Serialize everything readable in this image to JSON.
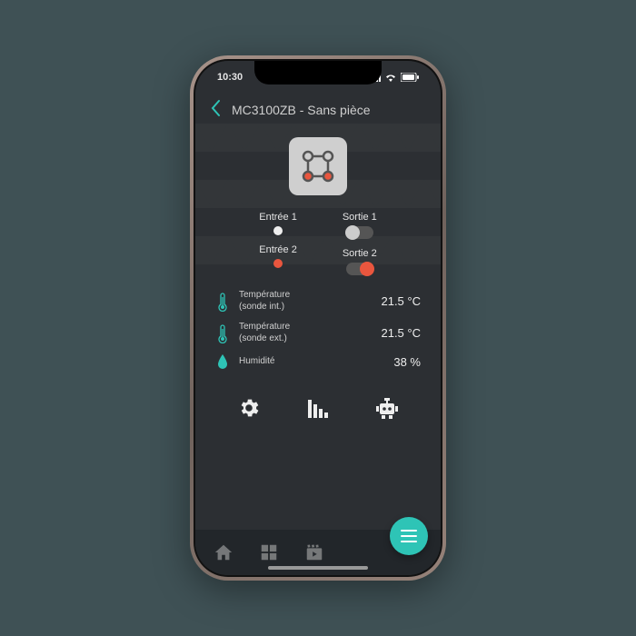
{
  "status": {
    "time": "10:30"
  },
  "header": {
    "title": "MC3100ZB - Sans pièce"
  },
  "io": {
    "input1_label": "Entrée 1",
    "input2_label": "Entrée 2",
    "output1_label": "Sortie 1",
    "output2_label": "Sortie 2"
  },
  "sensors": {
    "temp_int_label": "Température\n(sonde int.)",
    "temp_int_value": "21.5 °C",
    "temp_ext_label": "Température\n(sonde ext.)",
    "temp_ext_value": "21.5 °C",
    "humidity_label": "Humidité",
    "humidity_value": "38 %"
  },
  "colors": {
    "accent": "#2ec4b6",
    "alert": "#e9563e"
  }
}
